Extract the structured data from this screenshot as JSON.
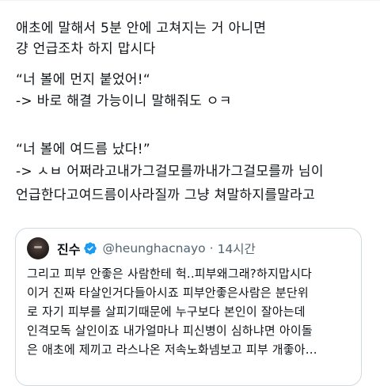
{
  "tweet": {
    "lines": [
      "애초에 말해서 5분 안에 고쳐지는 거 아니면",
      "걍 언급조차 하지 맙시다",
      "",
      "“너 볼에 먼지 붙었어!“",
      "-> 바로 해결 가능이니 말해줘도 ㅇㅋ",
      "",
      "“너 볼에 여드름 났다!”",
      "-> ㅅㅂ 어쩌라고내가그걸모를까내가그걸모를까 님이",
      "언급한다고여드름이사라질까 그냥 쳐말하지를말라고"
    ]
  },
  "quoted_tweet": {
    "author_name": "진수",
    "handle": "@heunghacnayo",
    "separator": "·",
    "time": "14시간",
    "lines": [
      "그리고 피부 안좋은 사람한테 헉..피부왜그래?하지맙시다",
      "이거 진짜 타살인거다들아시죠 피부안좋은사람은 분단위",
      "로 자기 피부를 살피기때문에 누구보다 본인이 잘아는데",
      "인격모독 살인이죠 내가얼마나 피신병이 심하냐면 아이돌",
      "은 애초에 제끼고 라스나온 저속노화넴보고 피부 개좋아..."
    ]
  },
  "colors": {
    "text": "#0f1419",
    "secondary": "#536471",
    "verified": "#1d9bf0",
    "border": "#cfd9de"
  },
  "icons": {
    "verified": "verified-badge-icon"
  }
}
